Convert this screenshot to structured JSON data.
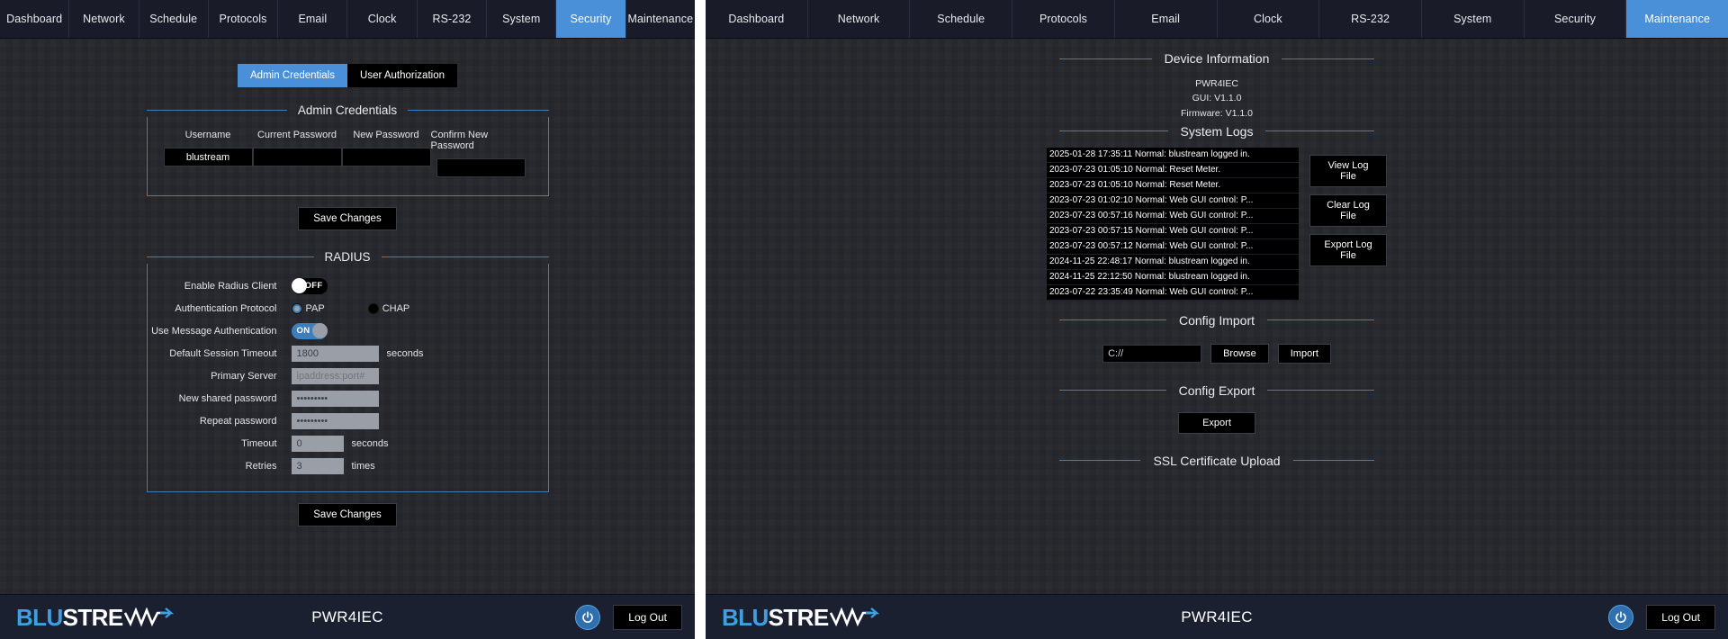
{
  "nav": {
    "items": [
      "Dashboard",
      "Network",
      "Schedule",
      "Protocols",
      "Email",
      "Clock",
      "RS-232",
      "System",
      "Security",
      "Maintenance"
    ],
    "left_active": "Security",
    "right_active": "Maintenance",
    "active_color": "#4a90d9"
  },
  "left": {
    "subtabs": [
      {
        "label": "Admin Credentials",
        "active": true
      },
      {
        "label": "User Authorization",
        "active": false
      }
    ],
    "admin_credentials": {
      "title": "Admin Credentials",
      "fields": [
        {
          "label": "Username",
          "value": "blustream",
          "placeholder": ""
        },
        {
          "label": "Current Password",
          "value": "",
          "placeholder": ""
        },
        {
          "label": "New Password",
          "value": "",
          "placeholder": ""
        },
        {
          "label": "Confirm New Password",
          "value": "",
          "placeholder": ""
        }
      ],
      "save_label": "Save Changes"
    },
    "radius": {
      "title": "RADIUS",
      "enable_label": "Enable Radius Client",
      "enable_state": "OFF",
      "auth_label": "Authentication Protocol",
      "auth_options": [
        "PAP",
        "CHAP"
      ],
      "auth_selected": "PAP",
      "msg_auth_label": "Use Message Authentication",
      "msg_auth_state": "ON",
      "session_label": "Default Session Timeout",
      "session_value": "1800",
      "session_unit": "seconds",
      "primary_label": "Primary Server",
      "primary_value": "",
      "primary_placeholder": "ipaddress:port#",
      "newpass_label": "New shared password",
      "newpass_value": "•••••••••",
      "repeatpass_label": "Repeat password",
      "repeatpass_value": "•••••••••",
      "timeout_label": "Timeout",
      "timeout_value": "0",
      "timeout_unit": "seconds",
      "retries_label": "Retries",
      "retries_value": "3",
      "retries_unit": "times",
      "save_label": "Save Changes"
    }
  },
  "right": {
    "device_information": {
      "title": "Device Information",
      "model": "PWR4IEC",
      "gui_version": "GUI: V1.1.0",
      "firmware_version": "Firmware: V1.1.0"
    },
    "system_logs": {
      "title": "System Logs",
      "entries": [
        "2025-01-28 17:35:11 Normal: blustream logged in.",
        "2023-07-23 01:05:10 Normal: Reset Meter.",
        "2023-07-23 01:05:10 Normal: Reset Meter.",
        "2023-07-23 01:02:10 Normal: Web GUI control: P...",
        "2023-07-23 00:57:16 Normal: Web GUI control: P...",
        "2023-07-23 00:57:15 Normal: Web GUI control: P...",
        "2023-07-23 00:57:12 Normal: Web GUI control: P...",
        "2024-11-25 22:48:17 Normal: blustream logged in.",
        "2024-11-25 22:12:50 Normal: blustream logged in.",
        "2023-07-22 23:35:49 Normal: Web GUI control: P..."
      ],
      "buttons": [
        "View Log File",
        "Clear Log File",
        "Export Log File"
      ]
    },
    "config_import": {
      "title": "Config Import",
      "path_value": "C://",
      "browse_label": "Browse",
      "import_label": "Import"
    },
    "config_export": {
      "title": "Config Export",
      "export_label": "Export"
    },
    "ssl": {
      "title": "SSL Certificate Upload"
    }
  },
  "footer": {
    "logo_blu": "BLU",
    "logo_stre": "STRE",
    "device_name": "PWR4IEC",
    "logout_label": "Log Out",
    "power_icon": "power-icon"
  }
}
